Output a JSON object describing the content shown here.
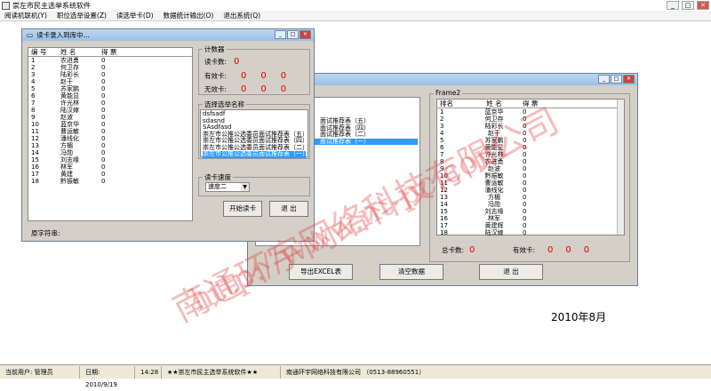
{
  "app": {
    "title": "崇左市民主选举系统软件"
  },
  "menu": [
    "阅读机联机(Y)",
    "职位选举设置(Z)",
    "读选举卡(D)",
    "数据统计输出(O)",
    "退出系统(Q)"
  ],
  "reader": {
    "title": "读卡录入到库中...",
    "headers": [
      "编  号",
      "姓  名",
      "得  票"
    ],
    "rows": [
      [
        "1",
        "农进勇",
        "0"
      ],
      [
        "2",
        "何卫存",
        "0"
      ],
      [
        "3",
        "陆彩长",
        "0"
      ],
      [
        "4",
        "赵干",
        "0"
      ],
      [
        "5",
        "苏家鹏",
        "0"
      ],
      [
        "6",
        "黄能显",
        "0"
      ],
      [
        "7",
        "许光林",
        "0"
      ],
      [
        "8",
        "陆汉嫁",
        "0"
      ],
      [
        "9",
        "赵波",
        "0"
      ],
      [
        "10",
        "蓝京华",
        "0"
      ],
      [
        "11",
        "曹运敏",
        "0"
      ],
      [
        "12",
        "潘线化",
        "0"
      ],
      [
        "13",
        "方楣",
        "0"
      ],
      [
        "14",
        "冯勋",
        "0"
      ],
      [
        "15",
        "刘志缘",
        "0"
      ],
      [
        "16",
        "林军",
        "0"
      ],
      [
        "17",
        "黄建",
        "0"
      ],
      [
        "18",
        "黔振敏",
        "0"
      ]
    ],
    "counter_legend": "计数器",
    "read_label": "读卡数:",
    "read_value": "0",
    "valid_label": "有效卡:",
    "valid_values": [
      "0",
      "0",
      "0"
    ],
    "invalid_label": "无效卡:",
    "invalid_values": [
      "0",
      "0",
      "0"
    ],
    "select_legend": "选择选举名称",
    "options": [
      "dsfsadf",
      "sdasnd",
      "SAsdfasd",
      "崇左市公推公选委员面试推荐表（五）",
      "崇左市公推公选委员面试推荐表（四）",
      "崇左市公推公选委员面试推荐表（二）",
      "崇左市公推公选委员面试推荐表（一）"
    ],
    "speed_legend": "读卡速度",
    "speed_value": "速度二",
    "start_button": "开始读卡",
    "exit_button": "退  出",
    "raw_label": "原字符串:"
  },
  "results": {
    "list_partial": [
      "面试推荐表（五）",
      "面试推荐表（四）",
      "面试推荐表（二）",
      "面试推荐表（一）"
    ],
    "frame_legend": "Frame2",
    "headers": [
      "排名",
      "姓  名",
      "得  票"
    ],
    "rows": [
      [
        "1",
        "蓝京华",
        "0"
      ],
      [
        "2",
        "何卫存",
        "0"
      ],
      [
        "3",
        "陆彩长",
        "0"
      ],
      [
        "4",
        "赵干",
        "0"
      ],
      [
        "5",
        "苏家鹏",
        "0"
      ],
      [
        "6",
        "黄能显",
        "0"
      ],
      [
        "7",
        "许光林",
        "0"
      ],
      [
        "8",
        "农进勇",
        "0"
      ],
      [
        "9",
        "赵波",
        "0"
      ],
      [
        "10",
        "黔振敏",
        "0"
      ],
      [
        "11",
        "曹运敏",
        "0"
      ],
      [
        "12",
        "潘线化",
        "0"
      ],
      [
        "13",
        "方楣",
        "0"
      ],
      [
        "14",
        "冯勋",
        "0"
      ],
      [
        "15",
        "刘志缘",
        "0"
      ],
      [
        "16",
        "林军",
        "0"
      ],
      [
        "17",
        "黄建辉",
        "0"
      ],
      [
        "18",
        "陆汉嫁",
        "0"
      ]
    ],
    "total_label": "总卡数:",
    "total_value": "0",
    "valid_label": "有效卡:",
    "valid_values": [
      "0",
      "0",
      "0"
    ],
    "export_button": "导出EXCEL表",
    "clear_button": "清空数据",
    "exit_button": "退  出"
  },
  "date_display": "2010年8月",
  "watermark": {
    "line1": "南通环宇网络科技有限公司",
    "line2": "http://www.nt-pc.com"
  },
  "statusbar": {
    "user": "当前用户: 管理员",
    "date": "日期: 2010/9/19",
    "time": "14:28",
    "app": "★★崇左市民主选举系统软件★★",
    "company": "南通环宇网络科技有限公司 （0513-88960551）"
  }
}
